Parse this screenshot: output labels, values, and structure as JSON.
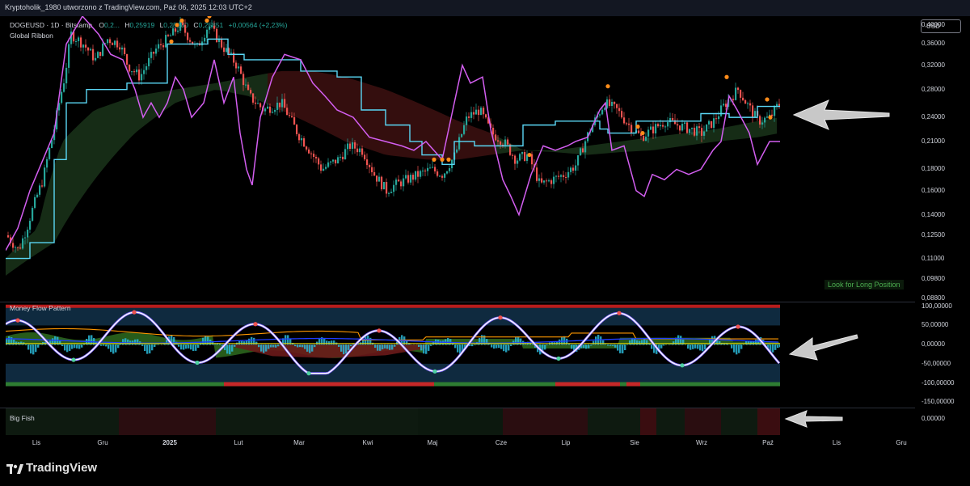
{
  "header": {
    "title": "Kryptoholik_1980 utworzono z TradingView.com, Paź 06, 2025 12:03 UTC+2"
  },
  "symbol": {
    "name": "DOGEUSD · 1D · Bitstamp",
    "o_label": "O",
    "o_value": "0,2...",
    "h_label": "H",
    "h_value": "0,25919",
    "l_label": "L",
    "l_value": "0,25080",
    "c_label": "C",
    "c_value": "0,25851",
    "change": "+0,00564 (+2,23%)",
    "indicator": "Global Ribbon"
  },
  "currency": "USD",
  "signal": "Look for Long Position",
  "panes": {
    "mfp_title": "Money Flow Pattern",
    "bigfish_title": "Big Fish"
  },
  "price_axis": [
    "0,40000",
    "0,36000",
    "0,32000",
    "0,28000",
    "0,24000",
    "0,21000",
    "0,18000",
    "0,16000",
    "0,14000",
    "0,12500",
    "0,11000",
    "0,09800",
    "0,08800"
  ],
  "mfp_axis": [
    "100,00000",
    "50,00000",
    "0,00000",
    "-50,00000",
    "-100,00000",
    "-150,00000"
  ],
  "bigfish_axis": [
    "0,00000"
  ],
  "time_axis": [
    "Lis",
    "Gru",
    "2025",
    "Lut",
    "Mar",
    "Kwi",
    "Maj",
    "Cze",
    "Lip",
    "Sie",
    "Wrz",
    "Paź",
    "Lis",
    "Gru"
  ],
  "brand": "TradingView",
  "colors": {
    "up": "#26a69a",
    "down": "#ef5350",
    "ribbon_line": "#5ad7f5",
    "oscillator": "#d35ef0",
    "dot": "#ff8c1a",
    "bull": "#1b5e20",
    "bear": "#b71c1c"
  },
  "chart_data": [
    {
      "type": "line",
      "title": "DOGEUSD · 1D · Bitstamp",
      "series": [
        {
          "name": "DOGEUSD close (approx.)",
          "x": [
            "Lis",
            "Gru",
            "2025",
            "Lut",
            "Mar",
            "Kwi",
            "Maj",
            "Cze",
            "Lip",
            "Sie",
            "Wrz",
            "Paź"
          ],
          "values": [
            0.125,
            0.38,
            0.38,
            0.32,
            0.19,
            0.165,
            0.19,
            0.21,
            0.165,
            0.22,
            0.23,
            0.258
          ]
        },
        {
          "name": "Global Ribbon",
          "x": [
            "Lis",
            "Gru",
            "2025",
            "Lut",
            "Mar",
            "Kwi",
            "Maj",
            "Cze",
            "Lip",
            "Sie",
            "Wrz",
            "Paź"
          ],
          "values": [
            0.115,
            0.3,
            0.355,
            0.335,
            0.33,
            0.28,
            0.185,
            0.205,
            0.225,
            0.215,
            0.235,
            0.255
          ]
        }
      ],
      "ylim": [
        0.088,
        0.42
      ],
      "ylog": true
    },
    {
      "type": "line",
      "title": "Money Flow Pattern",
      "series": [
        {
          "name": "oscillator",
          "x": [
            "Lis",
            "Gru",
            "2025",
            "Lut",
            "Mar",
            "Kwi",
            "Maj",
            "Cze",
            "Lip",
            "Sie",
            "Wrz",
            "Paź"
          ],
          "values": [
            40,
            30,
            10,
            -60,
            -55,
            10,
            70,
            -55,
            -60,
            90,
            20,
            -20
          ]
        }
      ],
      "ylim": [
        -150,
        100
      ]
    }
  ]
}
